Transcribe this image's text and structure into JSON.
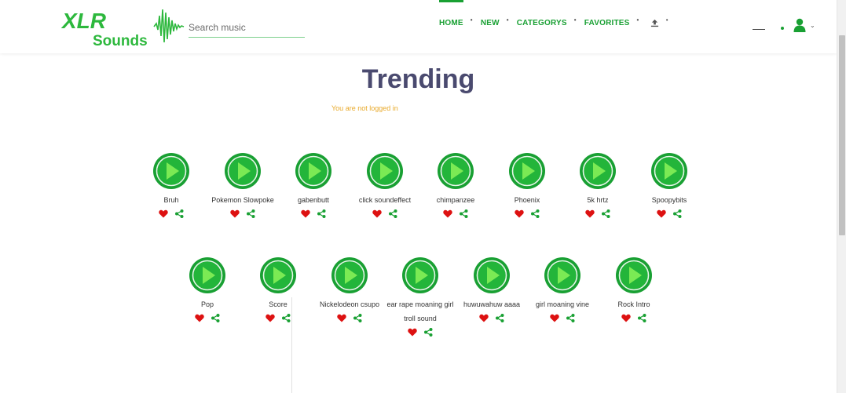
{
  "brand": {
    "line1": "XLR",
    "line2": "Sounds"
  },
  "search": {
    "placeholder": "Search music",
    "value": ""
  },
  "nav": {
    "items": [
      {
        "label": "HOME"
      },
      {
        "label": "NEW"
      },
      {
        "label": "CATEGORYS"
      },
      {
        "label": "FAVORITES"
      }
    ]
  },
  "icons": {
    "upload": "upload-icon",
    "user": "user-icon",
    "heart": "heart-icon",
    "share": "share-icon",
    "play": "play-icon"
  },
  "colors": {
    "accent": "#19a033",
    "heart": "#dd1111",
    "share": "#19a033",
    "notice": "#e8a92a",
    "title": "#4a4a6f"
  },
  "main": {
    "title": "Trending",
    "notice": "You are not logged in"
  },
  "sounds_row1": [
    {
      "name": "Bruh"
    },
    {
      "name": "Pokemon Slowpoke"
    },
    {
      "name": "gabenbutt"
    },
    {
      "name": "click soundeffect"
    },
    {
      "name": "chimpanzee"
    },
    {
      "name": "Phoenix"
    },
    {
      "name": "5k hrtz"
    },
    {
      "name": "Spoopybits"
    }
  ],
  "sounds_row2": [
    {
      "name": "Pop"
    },
    {
      "name": "Score"
    },
    {
      "name": "Nickelodeon csupo"
    },
    {
      "name": "ear rape moaning girl troll sound"
    },
    {
      "name": "huwuwahuw aaaa"
    },
    {
      "name": "girl moaning vine"
    },
    {
      "name": "Rock Intro"
    }
  ]
}
